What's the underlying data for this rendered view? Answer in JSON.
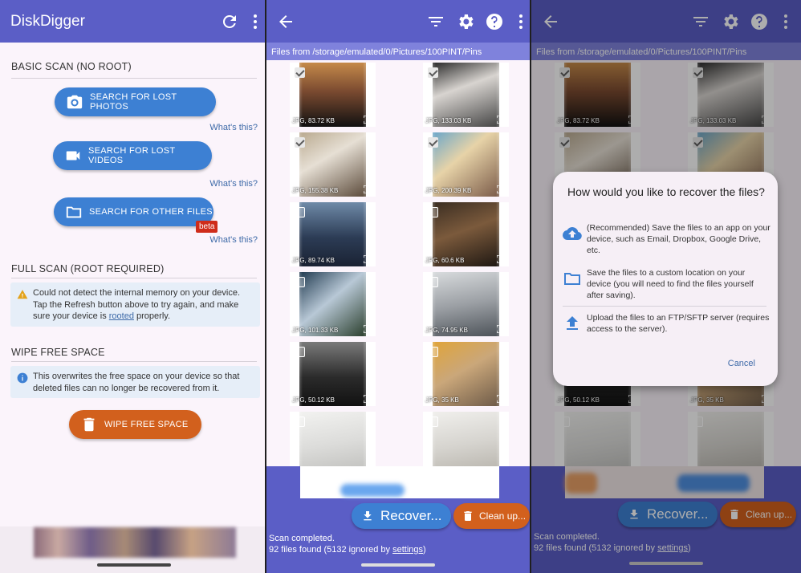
{
  "panel1": {
    "app_title": "DiskDigger",
    "icons": {
      "refresh": "refresh-icon",
      "more": "more-vert-icon"
    },
    "basic_scan": {
      "title": "BASIC SCAN (NO ROOT)",
      "photos_button": "SEARCH FOR LOST PHOTOS",
      "videos_button": "SEARCH FOR LOST VIDEOS",
      "files_button": "SEARCH FOR OTHER FILES",
      "beta_badge": "beta",
      "whats_this": "What's this?"
    },
    "full_scan": {
      "title": "FULL SCAN (ROOT REQUIRED)",
      "warning_text_1": "Could not detect the internal memory on your device. Tap the Refresh button above to try again, and make sure your device is ",
      "warning_link": "rooted",
      "warning_text_2": " properly."
    },
    "wipe": {
      "title": "WIPE FREE SPACE",
      "info_text": "This overwrites the free space on your device so that deleted files can no longer be recovered from it.",
      "button": "WIPE FREE SPACE"
    }
  },
  "results": {
    "path": "Files from /storage/emulated/0/Pictures/100PINT/Pins",
    "files": [
      {
        "caption": "JPG, 83.72 KB",
        "checked": true
      },
      {
        "caption": "JPG, 133.03 KB",
        "checked": true
      },
      {
        "caption": "JPG, 155.38 KB",
        "checked": true
      },
      {
        "caption": "JPG, 200.39 KB",
        "checked": true
      },
      {
        "caption": "JPG, 89.74 KB",
        "checked": false
      },
      {
        "caption": "JPG, 60.6 KB",
        "checked": false
      },
      {
        "caption": "JPG, 101.33 KB",
        "checked": false
      },
      {
        "caption": "JPG, 74.95 KB",
        "checked": false
      },
      {
        "caption": "JPG, 50.12 KB",
        "checked": false
      },
      {
        "caption": "JPG, 35 KB",
        "checked": false
      },
      {
        "caption": "",
        "checked": false
      },
      {
        "caption": "",
        "checked": false
      }
    ],
    "recover_button": "Recover...",
    "clean_button": "Clean up...",
    "status_line1": "Scan completed.",
    "status_line2_prefix": "92 files found (5132 ignored by ",
    "status_link": "settings",
    "status_line2_suffix": ")"
  },
  "dialog": {
    "title": "How would you like to recover the files?",
    "option1": "(Recommended) Save the files to an app on your device, such as Email, Dropbox, Google Drive, etc.",
    "option2": "Save the files to a custom location on your device (you will need to find the files yourself after saving).",
    "option3": "Upload the files to an FTP/SFTP server (requires access to the server).",
    "cancel": "Cancel"
  },
  "colors": {
    "appbar": "#5b5ec6",
    "accent_blue": "#3d80d3",
    "accent_orange": "#d2601d",
    "beta_red": "#cf2c1a"
  }
}
